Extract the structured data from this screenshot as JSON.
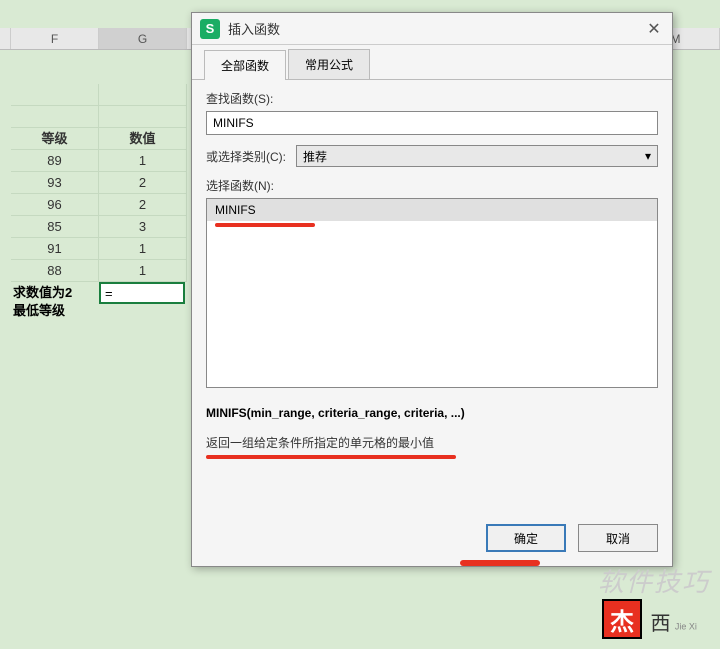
{
  "columns": {
    "F": "F",
    "G": "G",
    "M": "M"
  },
  "table": {
    "headers": {
      "level": "等级",
      "value": "数值"
    },
    "rows": [
      {
        "level": "89",
        "value": "1"
      },
      {
        "level": "93",
        "value": "2"
      },
      {
        "level": "96",
        "value": "2"
      },
      {
        "level": "85",
        "value": "3"
      },
      {
        "level": "91",
        "value": "1"
      },
      {
        "level": "88",
        "value": "1"
      }
    ],
    "label1": "求数值为2",
    "label2": "最低等级",
    "formula": "="
  },
  "dialog": {
    "title": "插入函数",
    "tabs": {
      "all": "全部函数",
      "common": "常用公式"
    },
    "search_label": "查找函数(S):",
    "search_value": "MINIFS",
    "category_label": "或选择类别(C):",
    "category_value": "推荐",
    "select_label": "选择函数(N):",
    "functions": [
      "MINIFS"
    ],
    "signature": "MINIFS(min_range, criteria_range, criteria, ...)",
    "description": "返回一组给定条件所指定的单元格的最小值",
    "ok": "确定",
    "cancel": "取消"
  },
  "watermark": {
    "text": "软件技巧",
    "logo": "杰",
    "sig": "西",
    "sub": "Jie Xi"
  }
}
